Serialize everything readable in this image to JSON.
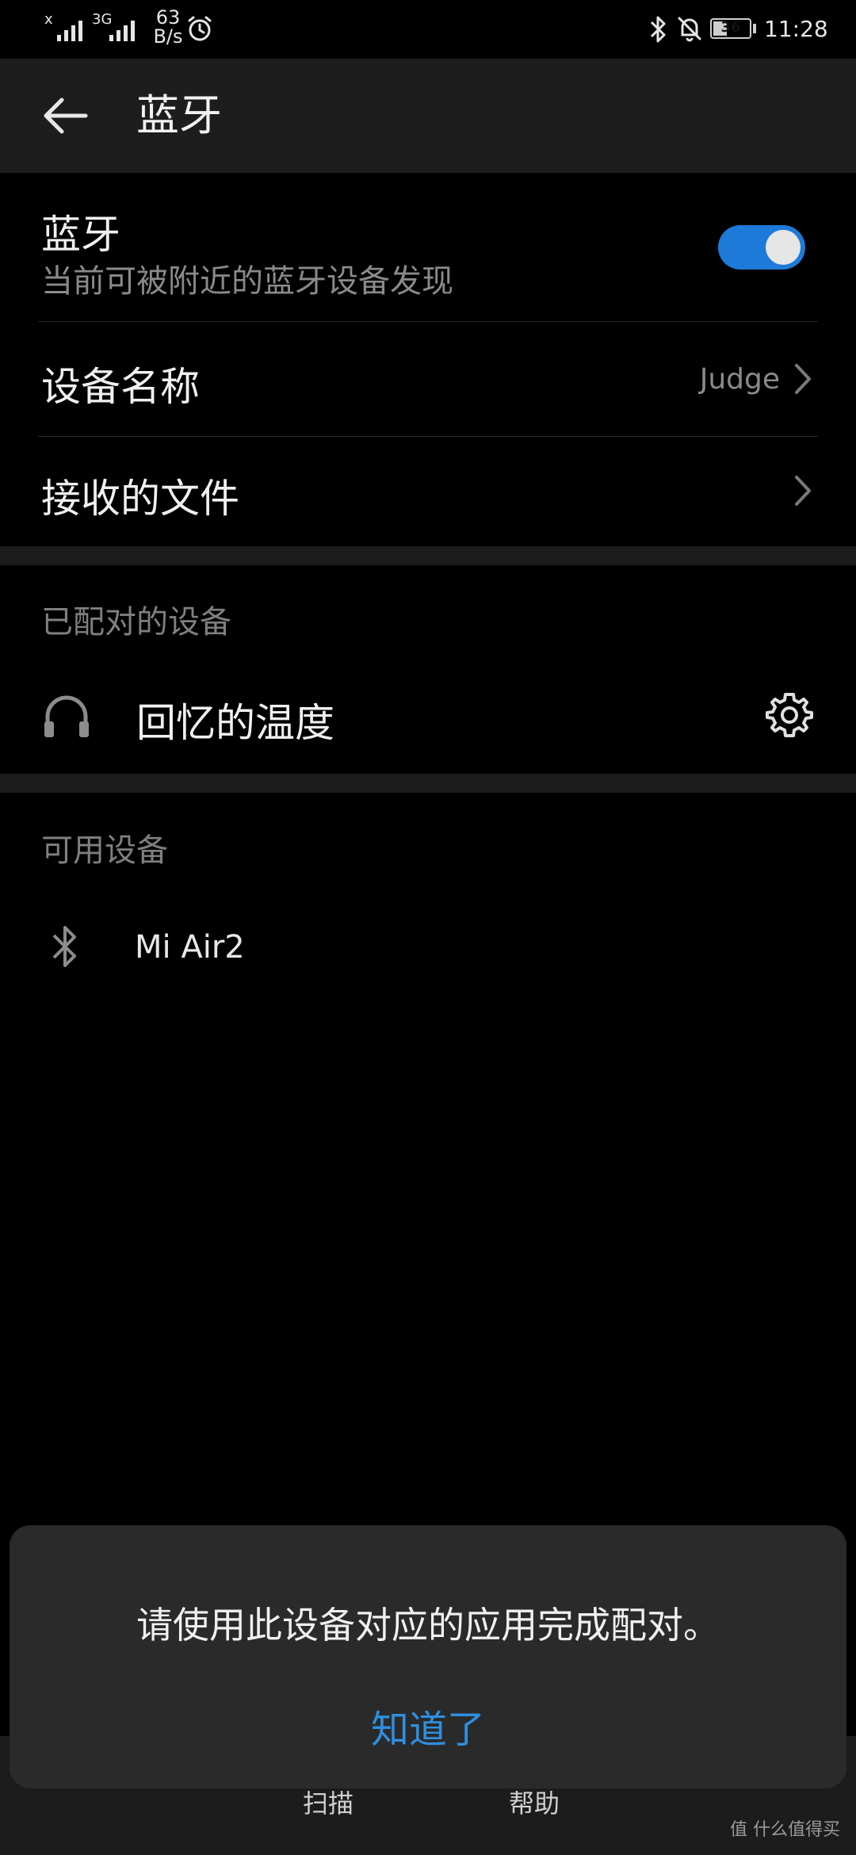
{
  "status_bar": {
    "sim1_type": "x",
    "sim2_type": "3G",
    "net_speed_value": "63",
    "net_speed_unit": "B/s",
    "battery_level": "36",
    "time": "11:28",
    "icons": [
      "signal-icon",
      "signal-icon",
      "alarm-icon",
      "bluetooth-icon",
      "bell-off-icon",
      "battery-icon"
    ]
  },
  "app_bar": {
    "back_icon": "arrow-left-icon",
    "title": "蓝牙"
  },
  "bluetooth_row": {
    "title": "蓝牙",
    "subtitle": "当前可被附近的蓝牙设备发现",
    "enabled": true,
    "accent_color": "#1e7ad8"
  },
  "device_name_row": {
    "label": "设备名称",
    "value": "Judge"
  },
  "received_files_row": {
    "label": "接收的文件"
  },
  "paired_section": {
    "header": "已配对的设备",
    "devices": [
      {
        "name": "回忆的温度",
        "icon": "headphones-icon",
        "action_icon": "gear-icon"
      }
    ]
  },
  "available_section": {
    "header": "可用设备",
    "devices": [
      {
        "name": "Mi Air2",
        "icon": "bluetooth-icon"
      }
    ]
  },
  "bottom_nav": {
    "items": [
      {
        "label": "扫描"
      },
      {
        "label": "帮助"
      }
    ]
  },
  "dialog": {
    "message": "请使用此设备对应的应用完成配对。",
    "button_label": "知道了",
    "button_color": "#2f8fe0"
  },
  "watermark": "值 什么值得买"
}
